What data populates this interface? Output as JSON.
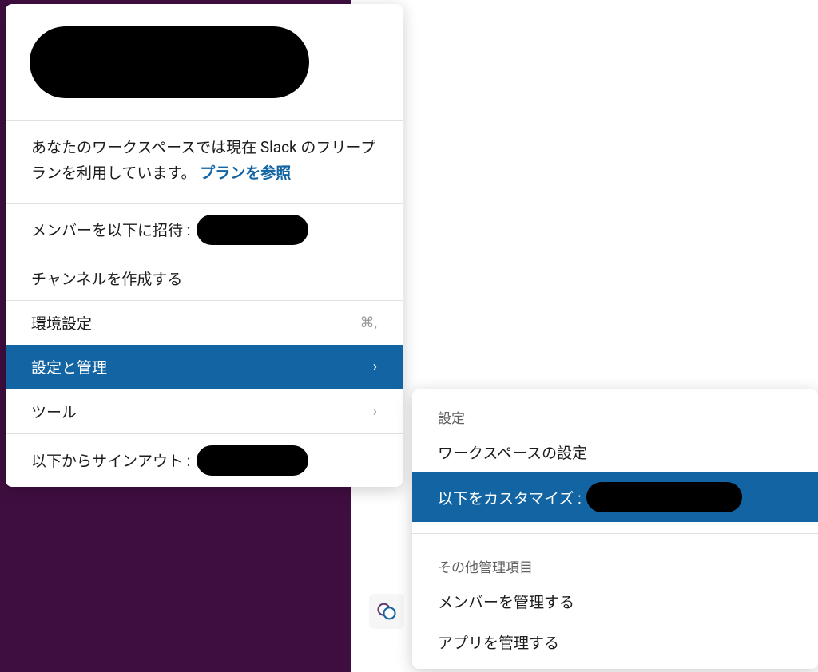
{
  "plan": {
    "text_prefix": "あなたのワークスペースでは現在 Slack のフリープランを利用しています。 ",
    "link": "プランを参照"
  },
  "menu": {
    "invite_prefix": "メンバーを以下に招待 :",
    "create_channel": "チャンネルを作成する",
    "preferences": "環境設定",
    "preferences_shortcut": "⌘,",
    "settings_admin": "設定と管理",
    "tools": "ツール",
    "sign_out_prefix": "以下からサインアウト :"
  },
  "submenu": {
    "section1_header": "設定",
    "workspace_settings": "ワークスペースの設定",
    "customize_prefix": "以下をカスタマイズ :",
    "section2_header": "その他管理項目",
    "manage_members": "メンバーを管理する",
    "manage_apps": "アプリを管理する"
  },
  "icons": {
    "chevron_right": "›"
  }
}
